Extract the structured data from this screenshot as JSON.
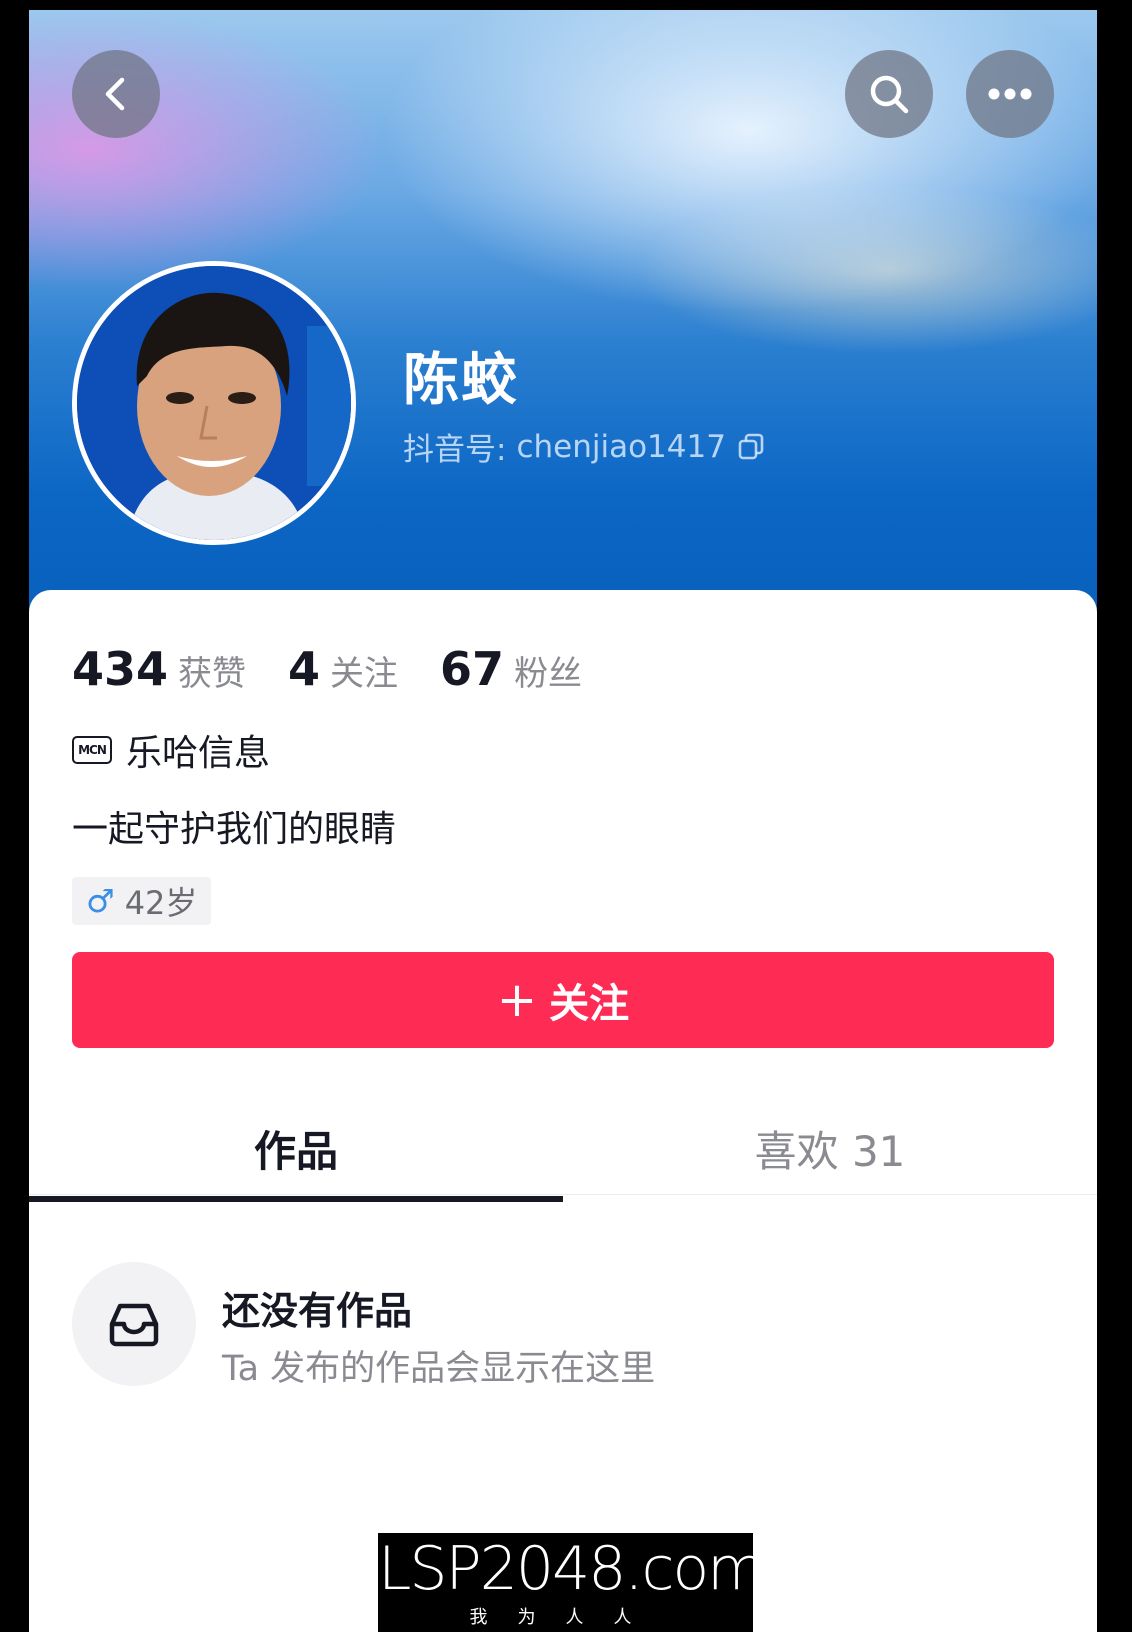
{
  "header": {
    "back_icon": "chevron-left-icon",
    "search_icon": "search-icon",
    "more_icon": "more-dots-icon"
  },
  "profile": {
    "name": "陈蛟",
    "account_prefix": "抖音号:",
    "account_id": "chenjiao1417",
    "copy_icon": "copy-icon"
  },
  "stats": [
    {
      "value": "434",
      "label": "获赞"
    },
    {
      "value": "4",
      "label": "关注"
    },
    {
      "value": "67",
      "label": "粉丝"
    }
  ],
  "mcn": {
    "badge": "MCN",
    "name": "乐哈信息"
  },
  "bio": "一起守护我们的眼睛",
  "gender_tag": {
    "symbol": "♂",
    "age": "42岁",
    "color": "#3a8ee6"
  },
  "follow_button": {
    "plus": "+",
    "label": "关注",
    "color": "#fe2c55"
  },
  "tabs": [
    {
      "label": "作品",
      "active": true
    },
    {
      "label": "喜欢 31",
      "active": false
    }
  ],
  "empty_state": {
    "icon": "inbox-icon",
    "title": "还没有作品",
    "subtitle": "Ta 发布的作品会显示在这里"
  },
  "watermark": {
    "main": "LSP2048.com",
    "sub": "我为人人"
  }
}
